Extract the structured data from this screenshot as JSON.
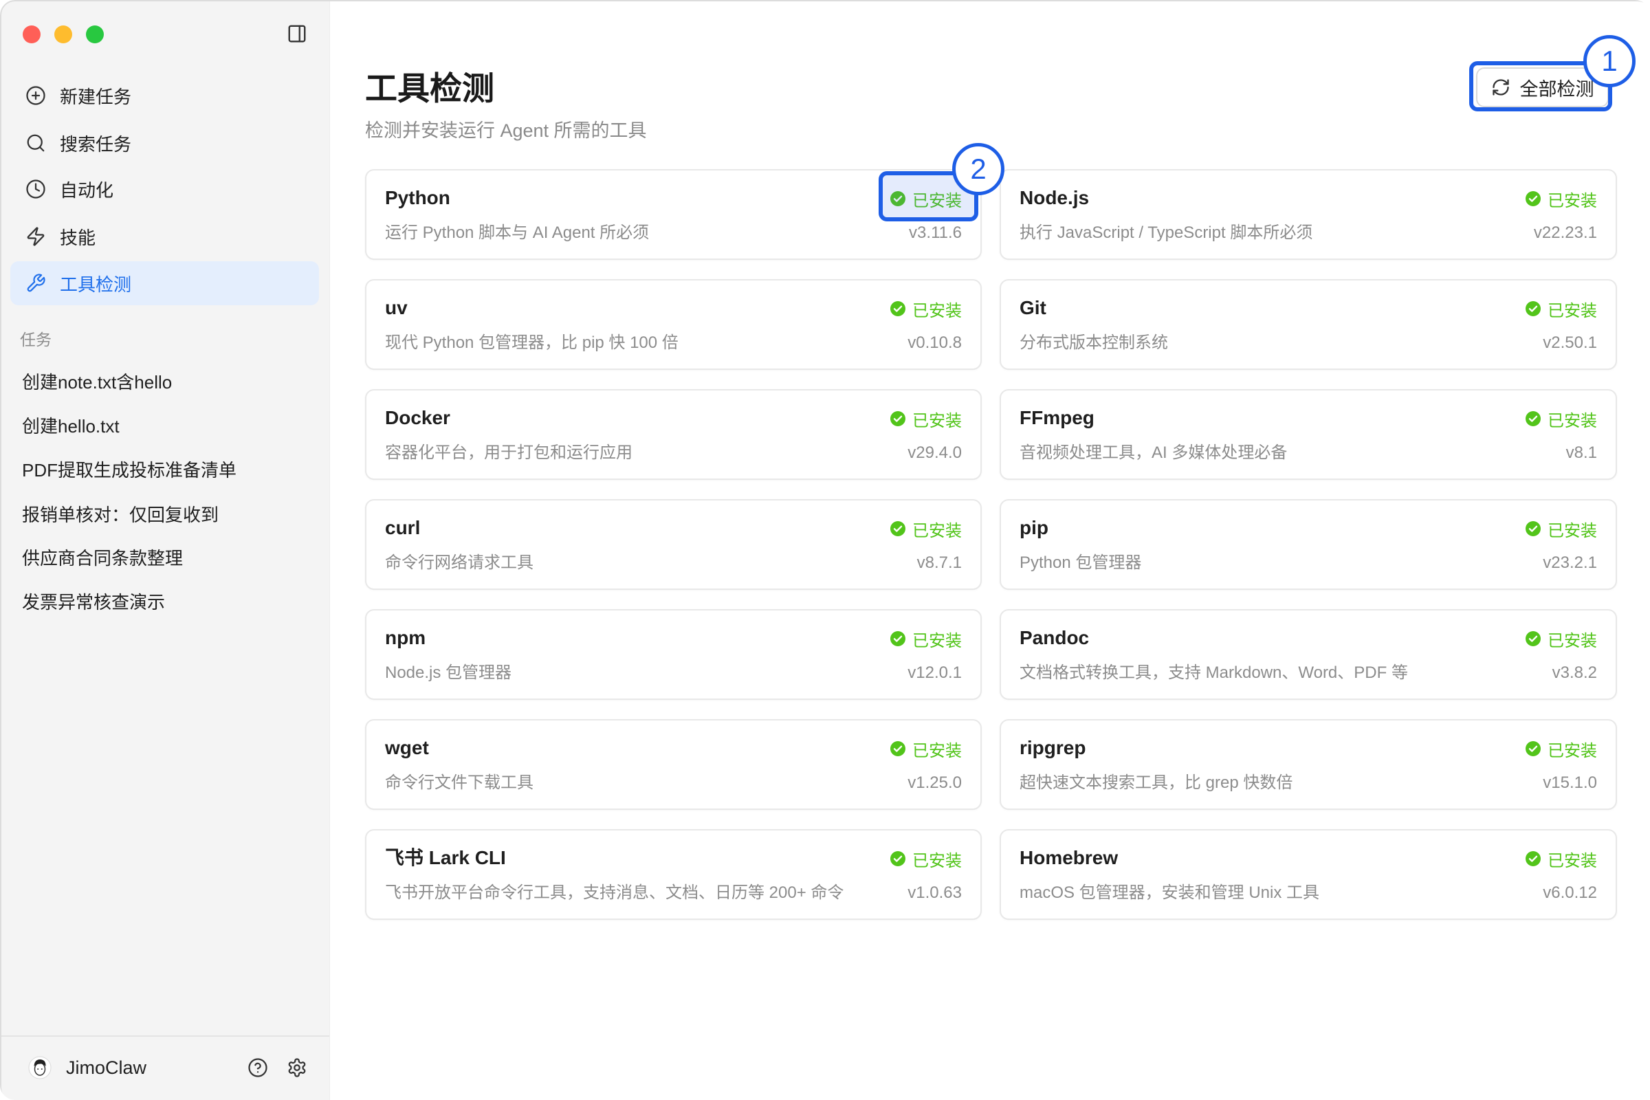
{
  "sidebar": {
    "toggle_icon": "sidebar-toggle-icon",
    "nav": [
      {
        "label": "新建任务",
        "icon": "plus-circle-icon",
        "active": false
      },
      {
        "label": "搜索任务",
        "icon": "search-icon",
        "active": false
      },
      {
        "label": "自动化",
        "icon": "clock-icon",
        "active": false
      },
      {
        "label": "技能",
        "icon": "lightning-icon",
        "active": false
      },
      {
        "label": "工具检测",
        "icon": "wrench-icon",
        "active": true
      }
    ],
    "section_label": "任务",
    "tasks": [
      "创建note.txt含hello",
      "创建hello.txt",
      "PDF提取生成投标准备清单",
      "报销单核对：仅回复收到",
      "供应商合同条款整理",
      "发票异常核查演示"
    ],
    "user": {
      "name": "JimoClaw",
      "avatar_icon": "avatar-icon"
    },
    "footer_icons": [
      "help-icon",
      "gear-icon"
    ]
  },
  "main": {
    "title": "工具检测",
    "subtitle": "检测并安装运行 Agent 所需的工具",
    "check_all_button": {
      "label": "全部检测",
      "icon": "refresh-icon"
    },
    "status_icon": "check-circle-icon",
    "tools": [
      {
        "name": "Python",
        "description": "运行 Python 脚本与 AI Agent 所必须",
        "status": "已安装",
        "version": "v3.11.6"
      },
      {
        "name": "Node.js",
        "description": "执行 JavaScript / TypeScript 脚本所必须",
        "status": "已安装",
        "version": "v22.23.1"
      },
      {
        "name": "uv",
        "description": "现代 Python 包管理器，比 pip 快 100 倍",
        "status": "已安装",
        "version": "v0.10.8"
      },
      {
        "name": "Git",
        "description": "分布式版本控制系统",
        "status": "已安装",
        "version": "v2.50.1"
      },
      {
        "name": "Docker",
        "description": "容器化平台，用于打包和运行应用",
        "status": "已安装",
        "version": "v29.4.0"
      },
      {
        "name": "FFmpeg",
        "description": "音视频处理工具，AI 多媒体处理必备",
        "status": "已安装",
        "version": "v8.1"
      },
      {
        "name": "curl",
        "description": "命令行网络请求工具",
        "status": "已安装",
        "version": "v8.7.1"
      },
      {
        "name": "pip",
        "description": "Python 包管理器",
        "status": "已安装",
        "version": "v23.2.1"
      },
      {
        "name": "npm",
        "description": "Node.js 包管理器",
        "status": "已安装",
        "version": "v12.0.1"
      },
      {
        "name": "Pandoc",
        "description": "文档格式转换工具，支持 Markdown、Word、PDF 等",
        "status": "已安装",
        "version": "v3.8.2"
      },
      {
        "name": "wget",
        "description": "命令行文件下载工具",
        "status": "已安装",
        "version": "v1.25.0"
      },
      {
        "name": "ripgrep",
        "description": "超快速文本搜索工具，比 grep 快数倍",
        "status": "已安装",
        "version": "v15.1.0"
      },
      {
        "name": "飞书 Lark CLI",
        "description": "飞书开放平台命令行工具，支持消息、文档、日历等 200+ 命令",
        "status": "已安装",
        "version": "v1.0.63"
      },
      {
        "name": "Homebrew",
        "description": "macOS 包管理器，安装和管理 Unix 工具",
        "status": "已安装",
        "version": "v6.0.12"
      }
    ]
  },
  "annotations": [
    {
      "label": "1"
    },
    {
      "label": "2"
    }
  ],
  "colors": {
    "accent": "#1f6feb",
    "active_bg": "#e4eefd",
    "success": "#52c41a",
    "annotation": "#1e5ee6",
    "sidebar_bg": "#f4f4f4"
  }
}
